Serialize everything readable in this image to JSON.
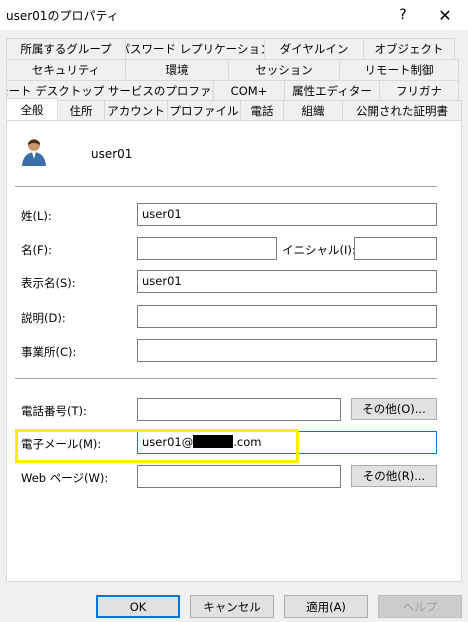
{
  "window": {
    "title": "user01のプロパティ",
    "help_glyph": "?",
    "close_glyph": "✕"
  },
  "tabs": {
    "row1": [
      "所属するグループ",
      "パスワード レプリケーション",
      "ダイヤルイン",
      "オブジェクト"
    ],
    "row2": [
      "セキュリティ",
      "環境",
      "セッション",
      "リモート制御"
    ],
    "row3": [
      "リモート デスクトップ サービスのプロファイル",
      "COM+",
      "属性エディター",
      "フリガナ"
    ],
    "row4": [
      "全般",
      "住所",
      "アカウント",
      "プロファイル",
      "電話",
      "組織",
      "公開された証明書"
    ],
    "active": "全般"
  },
  "general": {
    "user_name": "user01",
    "fields": {
      "last_name_label": "姓(L):",
      "last_name_value": "user01",
      "first_name_label": "名(F):",
      "first_name_value": "",
      "initials_label": "イニシャル(I):",
      "initials_value": "",
      "display_name_label": "表示名(S):",
      "display_name_value": "user01",
      "description_label": "説明(D):",
      "description_value": "",
      "office_label": "事業所(C):",
      "office_value": "",
      "phone_label": "電話番号(T):",
      "phone_value": "",
      "phone_other_button": "その他(O)...",
      "email_label": "電子メール(M):",
      "email_prefix": "user01@",
      "email_suffix": ".com",
      "webpage_label": "Web ページ(W):",
      "webpage_value": "",
      "webpage_other_button": "その他(R)..."
    }
  },
  "buttons": {
    "ok": "OK",
    "cancel": "キャンセル",
    "apply": "適用(A)",
    "help": "ヘルプ"
  },
  "colors": {
    "highlight": "#ffee00",
    "focus": "#0078d7"
  }
}
